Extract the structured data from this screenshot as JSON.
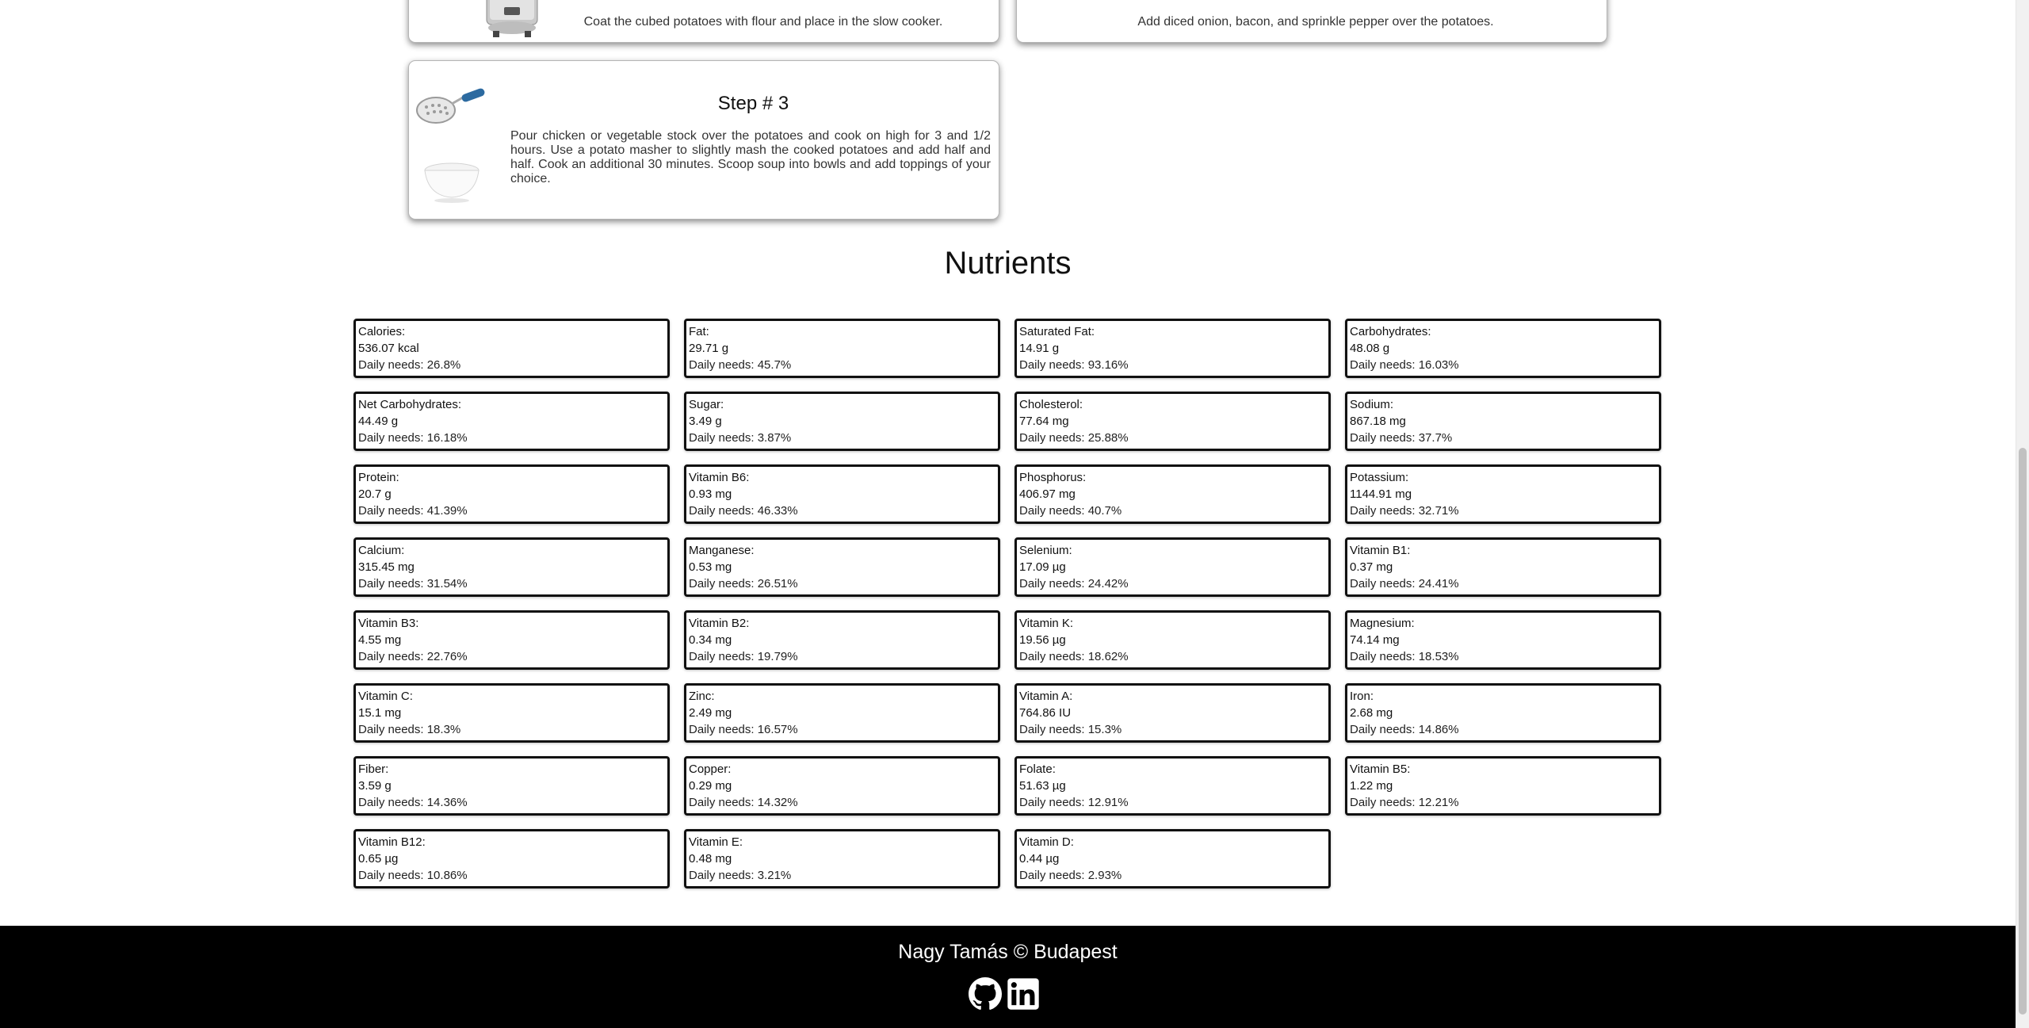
{
  "steps": [
    {
      "text": "Coat the cubed potatoes with flour and place in the slow cooker."
    },
    {
      "text": "Add diced onion, bacon, and sprinkle pepper over the potatoes."
    },
    {
      "title": "Step # 3",
      "text": "Pour chicken or vegetable stock over the potatoes and cook on high for 3 and 1/2 hours. Use a potato masher to slightly mash the cooked potatoes and add half and half. Cook an additional 30 minutes. Scoop soup into bowls and add toppings of your choice."
    }
  ],
  "nutrients": {
    "title": "Nutrients",
    "items": [
      {
        "name": "Calories:",
        "amount": "536.07 kcal",
        "daily": "Daily needs: 26.8%"
      },
      {
        "name": "Fat:",
        "amount": "29.71 g",
        "daily": "Daily needs: 45.7%"
      },
      {
        "name": "Saturated Fat:",
        "amount": "14.91 g",
        "daily": "Daily needs: 93.16%"
      },
      {
        "name": "Carbohydrates:",
        "amount": "48.08 g",
        "daily": "Daily needs: 16.03%"
      },
      {
        "name": "Net Carbohydrates:",
        "amount": "44.49 g",
        "daily": "Daily needs: 16.18%"
      },
      {
        "name": "Sugar:",
        "amount": "3.49 g",
        "daily": "Daily needs: 3.87%"
      },
      {
        "name": "Cholesterol:",
        "amount": "77.64 mg",
        "daily": "Daily needs: 25.88%"
      },
      {
        "name": "Sodium:",
        "amount": "867.18 mg",
        "daily": "Daily needs: 37.7%"
      },
      {
        "name": "Protein:",
        "amount": "20.7 g",
        "daily": "Daily needs: 41.39%"
      },
      {
        "name": "Vitamin B6:",
        "amount": "0.93 mg",
        "daily": "Daily needs: 46.33%"
      },
      {
        "name": "Phosphorus:",
        "amount": "406.97 mg",
        "daily": "Daily needs: 40.7%"
      },
      {
        "name": "Potassium:",
        "amount": "1144.91 mg",
        "daily": "Daily needs: 32.71%"
      },
      {
        "name": "Calcium:",
        "amount": "315.45 mg",
        "daily": "Daily needs: 31.54%"
      },
      {
        "name": "Manganese:",
        "amount": "0.53 mg",
        "daily": "Daily needs: 26.51%"
      },
      {
        "name": "Selenium:",
        "amount": "17.09 µg",
        "daily": "Daily needs: 24.42%"
      },
      {
        "name": "Vitamin B1:",
        "amount": "0.37 mg",
        "daily": "Daily needs: 24.41%"
      },
      {
        "name": "Vitamin B3:",
        "amount": "4.55 mg",
        "daily": "Daily needs: 22.76%"
      },
      {
        "name": "Vitamin B2:",
        "amount": "0.34 mg",
        "daily": "Daily needs: 19.79%"
      },
      {
        "name": "Vitamin K:",
        "amount": "19.56 µg",
        "daily": "Daily needs: 18.62%"
      },
      {
        "name": "Magnesium:",
        "amount": "74.14 mg",
        "daily": "Daily needs: 18.53%"
      },
      {
        "name": "Vitamin C:",
        "amount": "15.1 mg",
        "daily": "Daily needs: 18.3%"
      },
      {
        "name": "Zinc:",
        "amount": "2.49 mg",
        "daily": "Daily needs: 16.57%"
      },
      {
        "name": "Vitamin A:",
        "amount": "764.86 IU",
        "daily": "Daily needs: 15.3%"
      },
      {
        "name": "Iron:",
        "amount": "2.68 mg",
        "daily": "Daily needs: 14.86%"
      },
      {
        "name": "Fiber:",
        "amount": "3.59 g",
        "daily": "Daily needs: 14.36%"
      },
      {
        "name": "Copper:",
        "amount": "0.29 mg",
        "daily": "Daily needs: 14.32%"
      },
      {
        "name": "Folate:",
        "amount": "51.63 µg",
        "daily": "Daily needs: 12.91%"
      },
      {
        "name": "Vitamin B5:",
        "amount": "1.22 mg",
        "daily": "Daily needs: 12.21%"
      },
      {
        "name": "Vitamin B12:",
        "amount": "0.65 µg",
        "daily": "Daily needs: 10.86%"
      },
      {
        "name": "Vitamin E:",
        "amount": "0.48 mg",
        "daily": "Daily needs: 3.21%"
      },
      {
        "name": "Vitamin D:",
        "amount": "0.44 µg",
        "daily": "Daily needs: 2.93%"
      }
    ]
  },
  "footer": {
    "text": "Nagy Tamás © Budapest",
    "icons": [
      "github-icon",
      "linkedin-icon"
    ]
  },
  "colors": {
    "footer_bg": "#000000",
    "footer_text": "#ffffff",
    "card_border": "#111111"
  }
}
